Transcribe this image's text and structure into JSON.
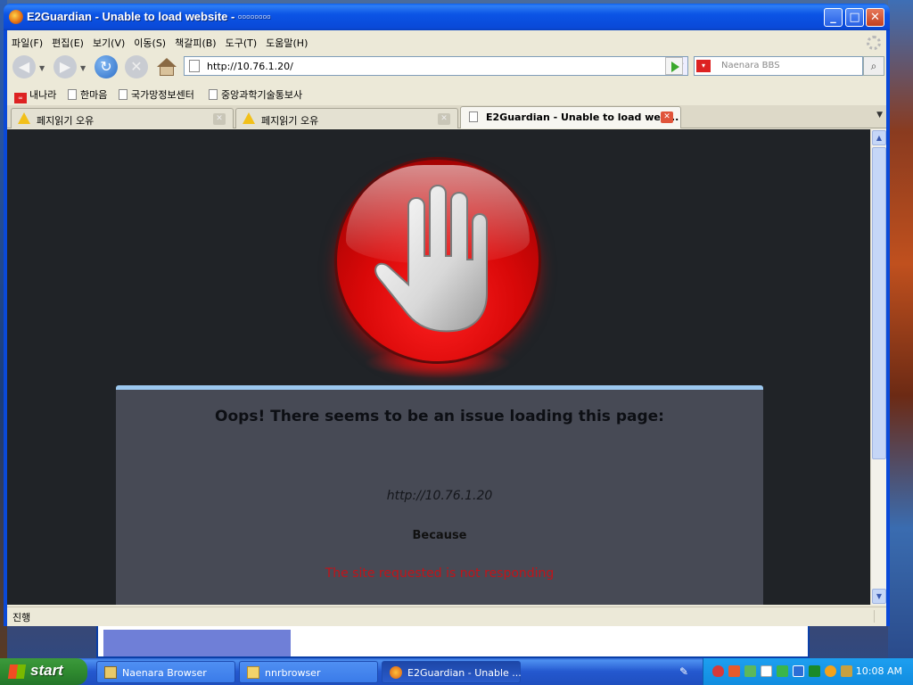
{
  "window": {
    "title": "E2Guardian - Unable to load website - ▫▫▫▫▫▫▫▫",
    "controls": {
      "minimize": "_",
      "maximize": "□",
      "close": "✕"
    }
  },
  "menu": [
    "파일(F)",
    "편집(E)",
    "보기(V)",
    "이동(S)",
    "책갈피(B)",
    "도구(T)",
    "도움말(H)"
  ],
  "nav": {
    "url": "http://10.76.1.20/",
    "search_placeholder": "Naenara BBS"
  },
  "bookmarks": [
    "내나라",
    "한마음",
    "국가망정보센터",
    "중앙과학기술통보사"
  ],
  "tabs": [
    {
      "label": "페지읽기 오유",
      "icon": "warning-icon",
      "active": false
    },
    {
      "label": "페지읽기 오유",
      "icon": "warning-icon",
      "active": false
    },
    {
      "label": "E2Guardian - Unable to load web...",
      "icon": "page-icon",
      "active": true
    }
  ],
  "page": {
    "heading": "Oops! There seems to be an issue loading this page:",
    "url": "http://10.76.1.20",
    "because": "Because",
    "reason": "The site requested is not responding"
  },
  "status": "진행",
  "taskbar": {
    "start": "start",
    "tasks": [
      {
        "label": "Naenara Browser",
        "icon": "browser-icon"
      },
      {
        "label": "nnrbrowser",
        "icon": "folder-icon"
      },
      {
        "label": "E2Guardian - Unable ...",
        "icon": "firefox-icon",
        "active": true
      }
    ],
    "clock": "10:08 AM"
  },
  "colors": {
    "content_bg": "#202327",
    "card_bg": "#474a55",
    "card_accent": "#9cc8ef",
    "reason_text": "#c0141a",
    "stop_red": "#d80808"
  }
}
